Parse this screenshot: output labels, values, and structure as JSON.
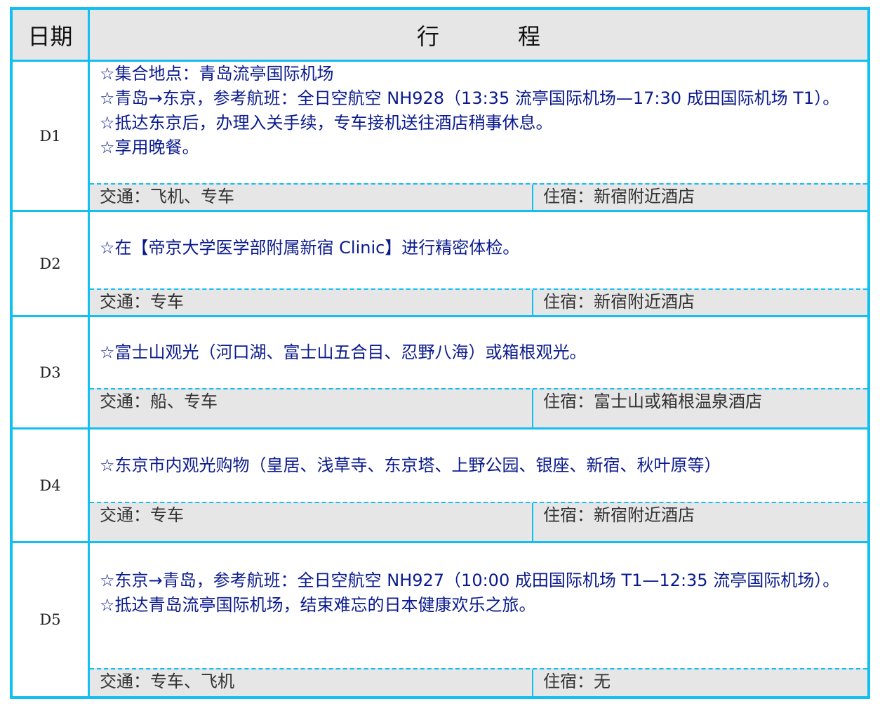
{
  "header": {
    "date_label": "日期",
    "plan_char_1": "行",
    "plan_char_2": "程"
  },
  "days": [
    {
      "label": "D1",
      "items": [
        "☆集合地点：青岛流亭国际机场",
        "☆青岛→东京，参考航班：全日空航空 NH928（13:35 流亭国际机场—17:30 成田国际机场 T1）。",
        "☆抵达东京后，办理入关手续，专车接机送往酒店稍事休息。",
        "☆享用晚餐。"
      ],
      "traffic": "交通：飞机、专车",
      "stay": "住宿：新宿附近酒店"
    },
    {
      "label": "D2",
      "items": [
        "☆在【帝京大学医学部附属新宿 Clinic】进行精密体检。"
      ],
      "traffic": "交通：专车",
      "stay": "住宿：新宿附近酒店"
    },
    {
      "label": "D3",
      "items": [
        "☆富士山观光（河口湖、富士山五合目、忍野八海）或箱根观光。"
      ],
      "traffic": "交通：船、专车",
      "stay": "住宿：富士山或箱根温泉酒店"
    },
    {
      "label": "D4",
      "items": [
        "☆东京市内观光购物（皇居、浅草寺、东京塔、上野公园、银座、新宿、秋叶原等）"
      ],
      "traffic": "交通：专车",
      "stay": "住宿：新宿附近酒店"
    },
    {
      "label": "D5",
      "items": [
        "☆东京→青岛，参考航班：全日空航空 NH927（10:00 成田国际机场 T1—12:35 流亭国际机场）。",
        "☆抵达青岛流亭国际机场，结束难忘的日本健康欢乐之旅。"
      ],
      "traffic": "交通：专车、飞机",
      "stay": "住宿：无"
    }
  ]
}
